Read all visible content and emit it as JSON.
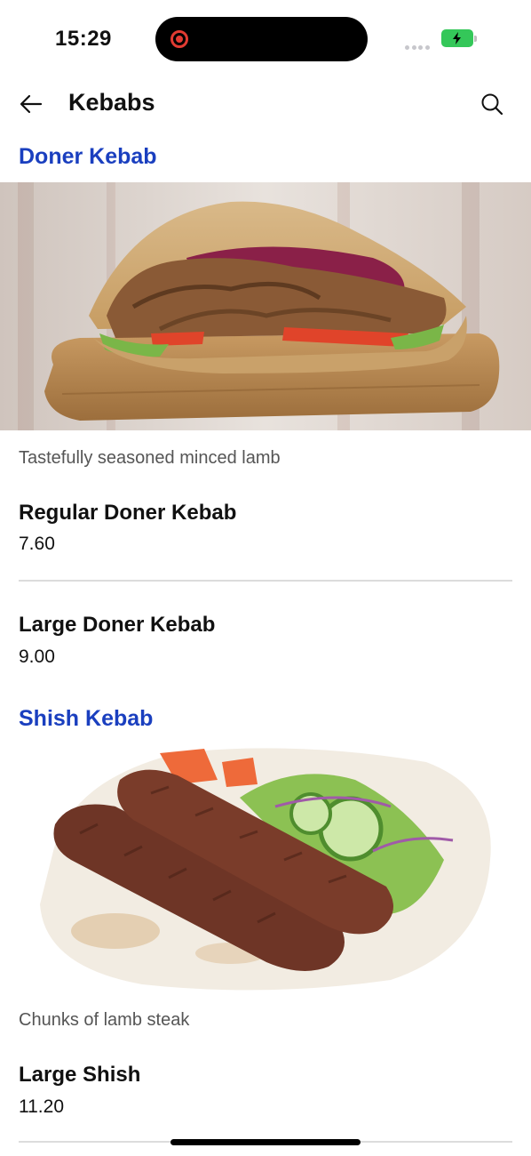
{
  "status_bar": {
    "time": "15:29"
  },
  "header": {
    "title": "Kebabs"
  },
  "sections": [
    {
      "title": "Doner Kebab",
      "description": "Tastefully seasoned minced lamb",
      "items": [
        {
          "name": "Regular Doner Kebab",
          "price": "7.60"
        },
        {
          "name": "Large Doner Kebab",
          "price": "9.00"
        }
      ]
    },
    {
      "title": "Shish Kebab",
      "description": "Chunks of lamb steak",
      "items": [
        {
          "name": "Large Shish",
          "price": "11.20"
        }
      ]
    }
  ],
  "icons": {
    "back": "arrow-left-icon",
    "search": "search-icon",
    "recording": "record-icon",
    "battery": "battery-charging-icon"
  },
  "colors": {
    "section_title": "#1a3fbf",
    "battery": "#34c759",
    "recording": "#e23b32"
  }
}
